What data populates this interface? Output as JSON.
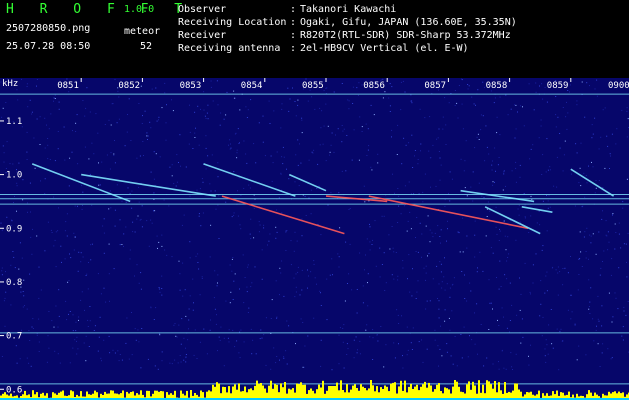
{
  "header": {
    "brand": "H R O F F T",
    "version": "1.0.0",
    "filename": "2507280850.png",
    "datetime": "25.07.28 08:50",
    "meteor_label": "meteor",
    "meteor_count": "52"
  },
  "info": [
    {
      "label": "Observer",
      "value": "Takanori Kawachi"
    },
    {
      "label": "Receiving Location",
      "value": "Ogaki, Gifu, JAPAN (136.60E, 35.35N)"
    },
    {
      "label": "Receiver",
      "value": "R820T2(RTL-SDR) SDR-Sharp 53.372MHz"
    },
    {
      "label": "Receiving antenna",
      "value": "2el-HB9CV Vertical (el. E-W)"
    }
  ],
  "chart_data": {
    "type": "heatmap",
    "ylabel": "kHz",
    "y_ticks": [
      "1.1",
      "1.0",
      "0.9",
      "0.8",
      "0.7",
      "0.6"
    ],
    "x_ticks": [
      "0851",
      "0852",
      "0853",
      "0854",
      "0855",
      "0856",
      "0857",
      "0858",
      "0859",
      "0900"
    ],
    "x_range": [
      "0850",
      "0900"
    ],
    "y_range": [
      0.58,
      1.18
    ],
    "colors": {
      "background": "#06066a",
      "noise": "#2f3fd0",
      "carrier": "#7fe6ff",
      "echo": "#ff5a5a",
      "bar": "#ffff00",
      "bar_base": "#00ccff"
    }
  }
}
